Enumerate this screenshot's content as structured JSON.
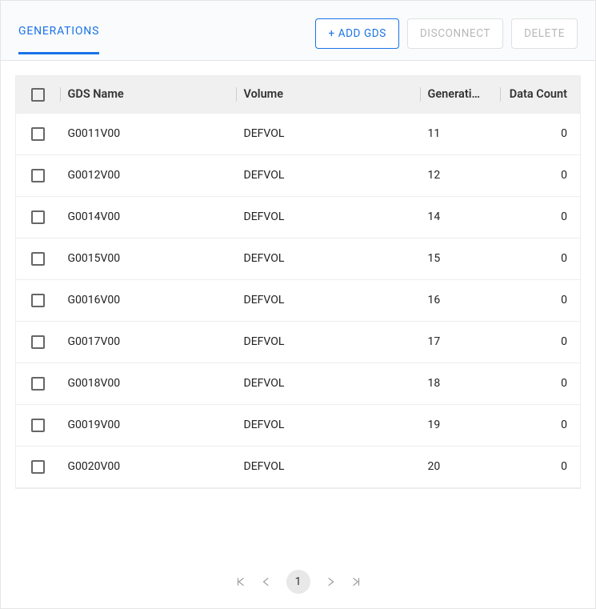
{
  "tabs": {
    "generations": "GENERATIONS"
  },
  "buttons": {
    "add_gds": "+ ADD GDS",
    "disconnect": "DISCONNECT",
    "delete": "DELETE"
  },
  "columns": {
    "name": "GDS Name",
    "volume": "Volume",
    "generation": "Generati…",
    "data_count": "Data Count"
  },
  "rows": [
    {
      "name": "G0011V00",
      "volume": "DEFVOL",
      "generation": "11",
      "data_count": "0"
    },
    {
      "name": "G0012V00",
      "volume": "DEFVOL",
      "generation": "12",
      "data_count": "0"
    },
    {
      "name": "G0014V00",
      "volume": "DEFVOL",
      "generation": "14",
      "data_count": "0"
    },
    {
      "name": "G0015V00",
      "volume": "DEFVOL",
      "generation": "15",
      "data_count": "0"
    },
    {
      "name": "G0016V00",
      "volume": "DEFVOL",
      "generation": "16",
      "data_count": "0"
    },
    {
      "name": "G0017V00",
      "volume": "DEFVOL",
      "generation": "17",
      "data_count": "0"
    },
    {
      "name": "G0018V00",
      "volume": "DEFVOL",
      "generation": "18",
      "data_count": "0"
    },
    {
      "name": "G0019V00",
      "volume": "DEFVOL",
      "generation": "19",
      "data_count": "0"
    },
    {
      "name": "G0020V00",
      "volume": "DEFVOL",
      "generation": "20",
      "data_count": "0"
    }
  ],
  "pagination": {
    "current": "1"
  }
}
